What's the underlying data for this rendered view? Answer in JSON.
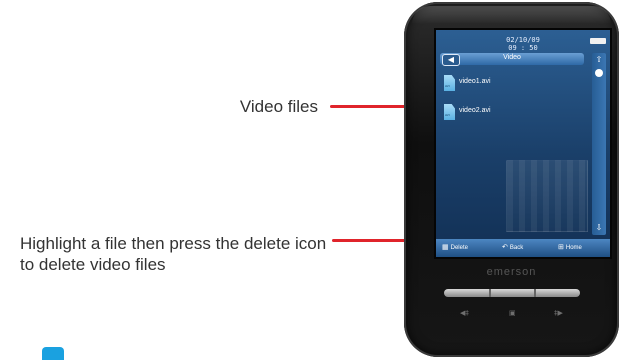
{
  "annotations": [
    {
      "text": "Video files"
    },
    {
      "text": "Highlight a file then press the delete icon to delete video files"
    }
  ],
  "device": {
    "brand": "emerson",
    "screen": {
      "date": "02/10/09",
      "time": "09 : 50",
      "title": "Video",
      "files": [
        {
          "name": "video1.avi",
          "icon": "avi-file-icon"
        },
        {
          "name": "video2.avi",
          "icon": "avi-file-icon"
        }
      ],
      "bottom_bar": {
        "delete": "Delete",
        "back": "Back",
        "home": "Home"
      }
    }
  },
  "colors": {
    "callout_line": "#e0242b",
    "screen": "#1a3f69",
    "accent_tab": "#1aa1e0"
  }
}
